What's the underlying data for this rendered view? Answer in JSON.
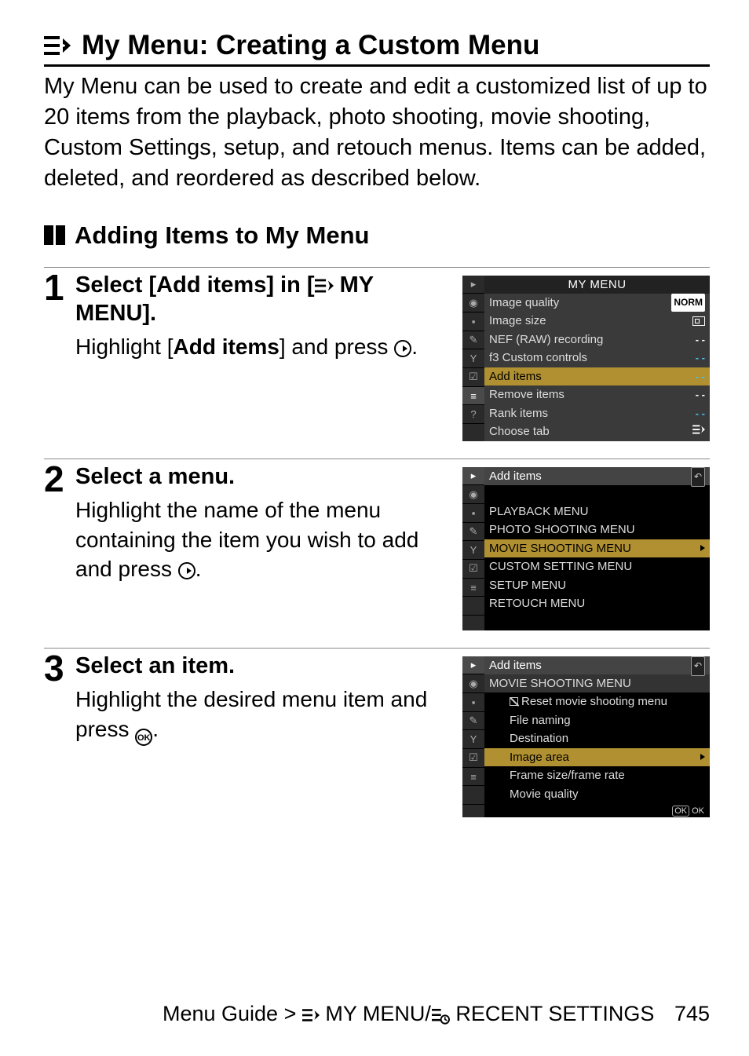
{
  "title": "My Menu: Creating a Custom Menu",
  "intro": "My Menu can be used to create and edit a customized list of up to 20 items from the playback, photo shooting, movie shooting, Custom Settings, setup, and retouch menus. Items can be added, deleted, and reordered as described below.",
  "subhead": "Adding Items to My Menu",
  "steps": [
    {
      "num": "1",
      "title_pre": "Select [Add items] in [",
      "title_post": " MY MENU].",
      "body_pre": "Highlight [",
      "body_bold": "Add items",
      "body_post": "] and press "
    },
    {
      "num": "2",
      "title": "Select a menu.",
      "body_pre": "Highlight the name of the menu containing the item you wish to add and press "
    },
    {
      "num": "3",
      "title": "Select an item.",
      "body_pre": "Highlight the desired menu item and press "
    }
  ],
  "shot1": {
    "title": "MY MENU",
    "rows": [
      {
        "label": "Image quality",
        "valtype": "norm",
        "val": "NORM"
      },
      {
        "label": "Image size",
        "valtype": "box"
      },
      {
        "label": "NEF (RAW) recording",
        "valtype": "dash-w",
        "val": "- -"
      },
      {
        "label": "f3 Custom controls",
        "valtype": "dash",
        "val": "- -",
        "prefix": true
      },
      {
        "label": "Add items",
        "sel": true,
        "valtype": "dash",
        "val": "- -"
      },
      {
        "label": "Remove items",
        "valtype": "dash-w",
        "val": "- -"
      },
      {
        "label": "Rank items",
        "valtype": "dash",
        "val": "- -"
      },
      {
        "label": "Choose tab",
        "valtype": "mymenu"
      }
    ]
  },
  "shot2": {
    "title": "Add items",
    "rows": [
      "PLAYBACK MENU",
      "PHOTO SHOOTING MENU",
      "MOVIE SHOOTING MENU",
      "CUSTOM SETTING MENU",
      "SETUP MENU",
      "RETOUCH MENU"
    ],
    "hl_index": 2
  },
  "shot3": {
    "title": "Add items",
    "header": "MOVIE SHOOTING MENU",
    "rows": [
      {
        "label": "Reset movie shooting menu",
        "reset": true
      },
      {
        "label": "File naming"
      },
      {
        "label": "Destination"
      },
      {
        "label": "Image area",
        "hl": true
      },
      {
        "label": "Frame size/frame rate"
      },
      {
        "label": "Movie quality"
      }
    ],
    "ok": "OK"
  },
  "footer": {
    "prefix": "Menu Guide > ",
    "mid": " MY MENU/",
    "suffix": " RECENT SETTINGS",
    "page": "745"
  }
}
